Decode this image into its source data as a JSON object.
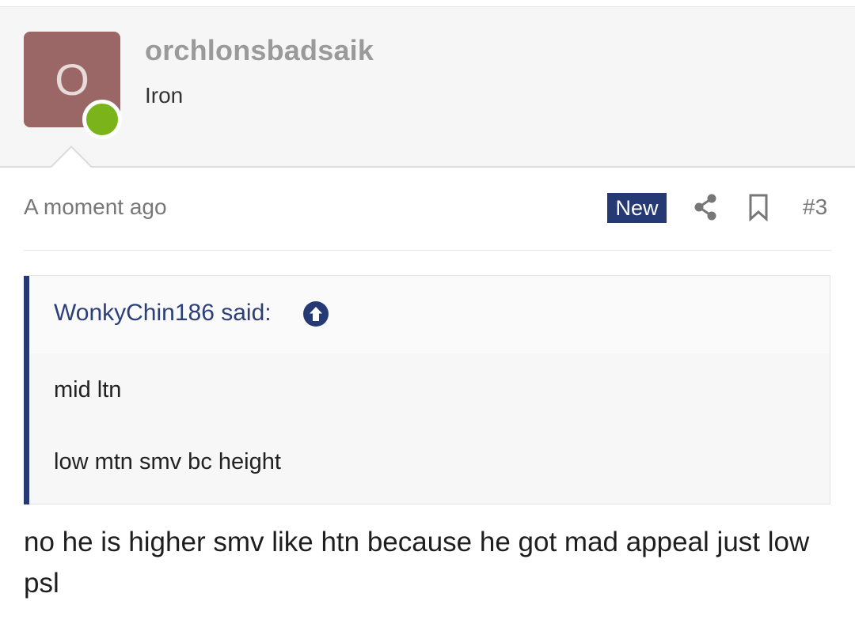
{
  "author": {
    "avatar_letter": "O",
    "username": "orchlonsbadsaik",
    "user_title": "Iron",
    "online_status_color": "#7bb31a",
    "avatar_color": "#9a6666"
  },
  "post_meta": {
    "timestamp": "A moment ago",
    "new_badge": "New",
    "post_number": "#3",
    "icons": [
      "share-icon",
      "bookmark-icon"
    ]
  },
  "quote": {
    "author_line": "WonkyChin186 said:",
    "icon": "arrow-up-circle-icon",
    "lines": [
      "mid ltn",
      "low mtn smv bc height"
    ]
  },
  "post_body": "no he is higher smv like htn because he got mad appeal just low psl",
  "colors": {
    "accent": "#253a75",
    "header_bg": "#f6f6f6"
  }
}
